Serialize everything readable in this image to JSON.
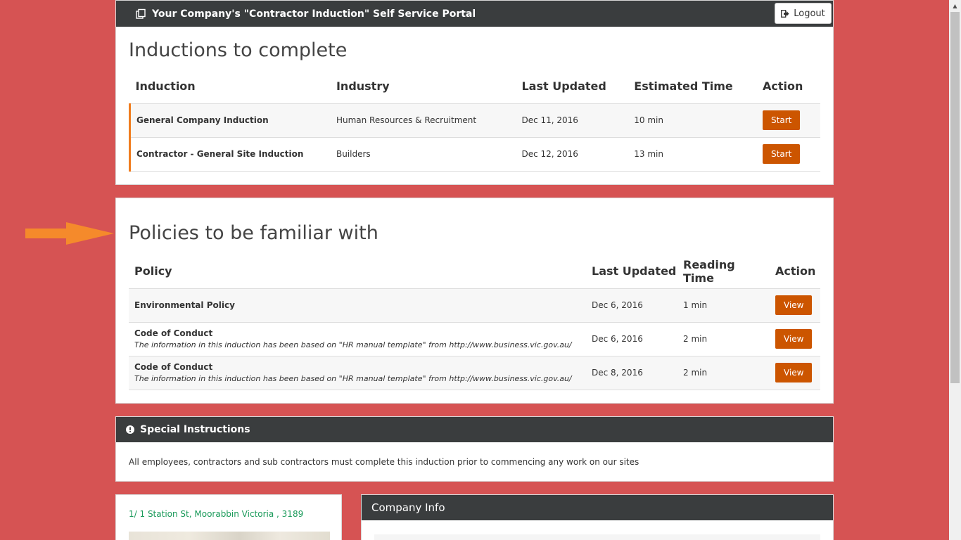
{
  "header": {
    "portal_title": "Your Company's \"Contractor Induction\" Self Service Portal",
    "logout_label": "Logout"
  },
  "inductions": {
    "title": "Inductions to complete",
    "columns": [
      "Induction",
      "Industry",
      "Last Updated",
      "Estimated Time",
      "Action"
    ],
    "rows": [
      {
        "name": "General Company Induction",
        "industry": "Human Resources & Recruitment",
        "updated": "Dec 11, 2016",
        "time": "10 min",
        "action": "Start"
      },
      {
        "name": "Contractor - General Site Induction",
        "industry": "Builders",
        "updated": "Dec 12, 2016",
        "time": "13 min",
        "action": "Start"
      }
    ]
  },
  "policies": {
    "title": "Policies to be familiar with",
    "columns": [
      "Policy",
      "Last Updated",
      "Reading Time",
      "Action"
    ],
    "rows": [
      {
        "name": "Environmental Policy",
        "note": "",
        "updated": "Dec 6, 2016",
        "time": "1 min",
        "action": "View"
      },
      {
        "name": "Code of Conduct",
        "note": "The information in this induction has been based on \"HR manual template\" from http://www.business.vic.gov.au/",
        "updated": "Dec 6, 2016",
        "time": "2 min",
        "action": "View"
      },
      {
        "name": "Code of Conduct",
        "note": "The information in this induction has been based on \"HR manual template\" from http://www.business.vic.gov.au/",
        "updated": "Dec 8, 2016",
        "time": "2 min",
        "action": "View"
      }
    ]
  },
  "special": {
    "title": "Special Instructions",
    "text": "All employees, contractors and sub contractors must complete this induction prior to commencing any work on our sites"
  },
  "address": {
    "text": "1/ 1 Station St, Moorabbin Victoria , 3189"
  },
  "company": {
    "title": "Company Info"
  },
  "colors": {
    "background": "#d65353",
    "header_bar": "#3a3d3e",
    "button": "#cc5500",
    "accent": "#f07c1e",
    "link": "#1a9a5a"
  },
  "icons": [
    "portal-icon",
    "logout-icon",
    "exclamation-icon",
    "arrow-icon"
  ]
}
